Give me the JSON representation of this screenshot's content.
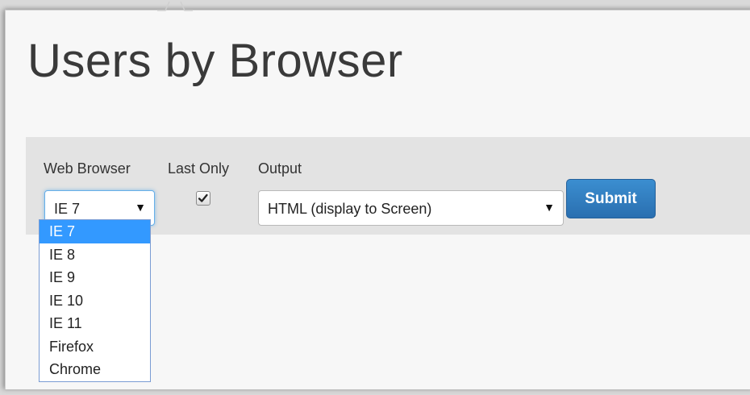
{
  "page": {
    "title": "Users by Browser"
  },
  "filters": {
    "web_browser": {
      "label": "Web Browser",
      "selected": "IE 7",
      "options": [
        "IE 7",
        "IE 8",
        "IE 9",
        "IE 10",
        "IE 11",
        "Firefox",
        "Chrome"
      ]
    },
    "last_only": {
      "label": "Last Only",
      "checked": true
    },
    "output": {
      "label": "Output",
      "selected": "HTML (display to Screen)"
    },
    "submit_label": "Submit"
  },
  "colors": {
    "accent": "#2a6fb0",
    "selected_option": "#3399ff",
    "focus_glow": "#66afe9"
  }
}
